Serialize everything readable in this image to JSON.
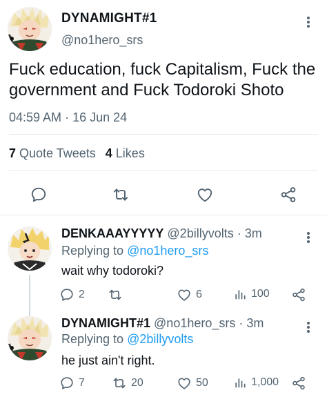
{
  "main_tweet": {
    "display_name": "DYNAMIGHT#1",
    "handle": "@no1hero_srs",
    "text": "Fuck education, fuck Capitalism, Fuck the government and Fuck Todoroki Shoto",
    "time": "04:59 AM",
    "separator": "·",
    "date": "16 Jun 24",
    "quote_tweets_count": "7",
    "quote_tweets_label": "Quote Tweets",
    "likes_count": "4",
    "likes_label": "Likes"
  },
  "replies": [
    {
      "display_name": "DENKAAAYYYYY",
      "handle": "@2billyvolts",
      "separator": "·",
      "age": "3m",
      "replying_prefix": "Replying to",
      "replying_to": "@no1hero_srs",
      "text": "wait why todoroki?",
      "reply_count": "2",
      "retweet_count": "",
      "like_count": "6",
      "view_count": "100"
    },
    {
      "display_name": "DYNAMIGHT#1",
      "handle": "@no1hero_srs",
      "separator": "·",
      "age": "3m",
      "replying_prefix": "Replying to",
      "replying_to": "@2billyvolts",
      "text": "he just ain't right.",
      "reply_count": "7",
      "retweet_count": "20",
      "like_count": "50",
      "view_count": "1,000"
    }
  ],
  "icons": {
    "reply": "comment-icon",
    "retweet": "retweet-icon",
    "like": "heart-icon",
    "share": "share-icon",
    "views": "views-icon",
    "more": "more-vertical-icon"
  },
  "colors": {
    "text": "#0f1419",
    "secondary": "#536471",
    "mention": "#1d9bf0",
    "divider": "#e6e9eb"
  }
}
